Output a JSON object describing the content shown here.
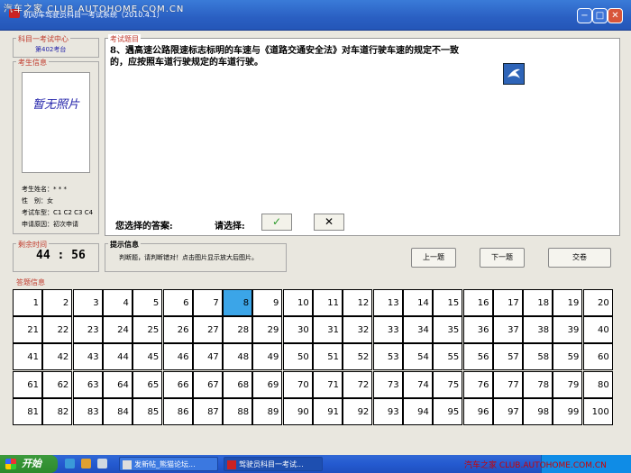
{
  "watermark_top": "汽车之家 CLUB.AUTOHOME.COM.CN",
  "window": {
    "title": "机动车驾驶员科目一考试系统（2010.4.1）",
    "min": "−",
    "max": "□",
    "close": "✕"
  },
  "center": {
    "legend": "科目一考试中心",
    "seat": "第402考台"
  },
  "examinee": {
    "legend": "考生信息",
    "photo_text": "暂无照片",
    "name": "考生姓名：* * *",
    "gender": "性　别：女",
    "car_type": "考试车型：C1 C2 C3 C4",
    "reason": "申请原因：初次申请"
  },
  "question": {
    "legend": "考试题目",
    "text": "8、遇高速公路限速标志标明的车速与《道路交通安全法》对车道行驶车速的规定不一致的，应按照车道行驶规定的车道行驶。"
  },
  "answer": {
    "your_answer_label": "您选择的答案:",
    "choose_label": "请选择:",
    "yes_symbol": "✓",
    "no_symbol": "✕",
    "yes_color": "#2a9a2a",
    "no_color": "#000000"
  },
  "timer": {
    "legend": "剩余时间",
    "value": "44 : 56"
  },
  "tips": {
    "legend": "提示信息",
    "text": "判断题，请判断错对！点击图片显示放大后图片。"
  },
  "nav": {
    "prev": "上一题",
    "next": "下一题",
    "submit": "交卷"
  },
  "answer_info": {
    "legend": "答题信息",
    "current": 8,
    "numbers": [
      1,
      2,
      3,
      4,
      5,
      6,
      7,
      8,
      9,
      10,
      11,
      12,
      13,
      14,
      15,
      16,
      17,
      18,
      19,
      20,
      21,
      22,
      23,
      24,
      25,
      26,
      27,
      28,
      29,
      30,
      31,
      32,
      33,
      34,
      35,
      36,
      37,
      38,
      39,
      40,
      41,
      42,
      43,
      44,
      45,
      46,
      47,
      48,
      49,
      50,
      51,
      52,
      53,
      54,
      55,
      56,
      57,
      58,
      59,
      60,
      61,
      62,
      63,
      64,
      65,
      66,
      67,
      68,
      69,
      70,
      71,
      72,
      73,
      74,
      75,
      76,
      77,
      78,
      79,
      80,
      81,
      82,
      83,
      84,
      85,
      86,
      87,
      88,
      89,
      90,
      91,
      92,
      93,
      94,
      95,
      96,
      97,
      98,
      99,
      100
    ]
  },
  "taskbar": {
    "start": "开始",
    "tasks": [
      "发新帖_熊猫论坛...",
      "驾驶员科目一考试..."
    ],
    "watermark": "汽车之家 CLUB.AUTOHOME.COM.CN"
  },
  "colors": {
    "accent": "#3ba5e8",
    "legend_text": "#c0392b",
    "titlebar": "#2a5fc2"
  }
}
